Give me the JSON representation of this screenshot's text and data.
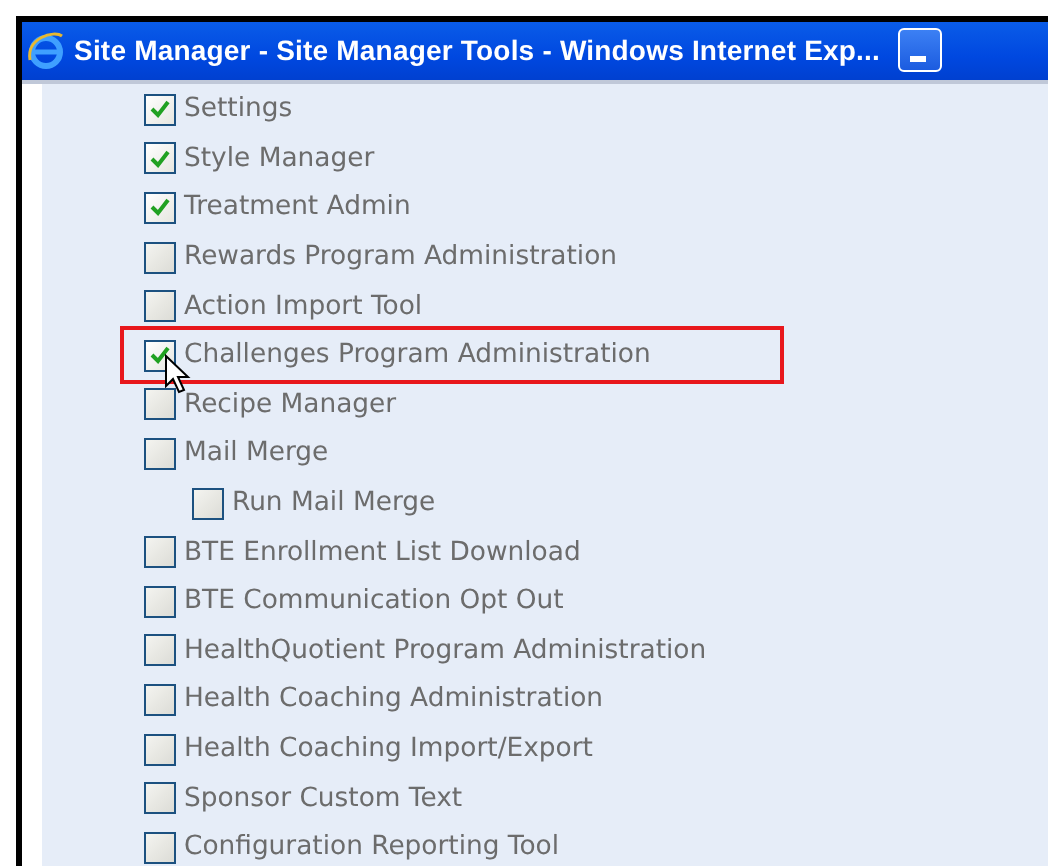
{
  "window": {
    "title": "Site Manager - Site Manager Tools - Windows Internet Exp..."
  },
  "items": [
    {
      "label": "Settings",
      "checked": true,
      "highlighted": false
    },
    {
      "label": "Style Manager",
      "checked": true,
      "highlighted": false
    },
    {
      "label": "Treatment Admin",
      "checked": true,
      "highlighted": false
    },
    {
      "label": "Rewards Program Administration",
      "checked": false,
      "highlighted": false
    },
    {
      "label": "Action Import Tool",
      "checked": false,
      "highlighted": false
    },
    {
      "label": "Challenges Program Administration",
      "checked": true,
      "highlighted": true
    },
    {
      "label": "Recipe Manager",
      "checked": false,
      "highlighted": false
    },
    {
      "label": "Mail Merge",
      "checked": false,
      "highlighted": false,
      "children": [
        {
          "label": "Run Mail Merge",
          "checked": false,
          "highlighted": false
        }
      ]
    },
    {
      "label": "BTE Enrollment List Download",
      "checked": false,
      "highlighted": false
    },
    {
      "label": "BTE Communication Opt Out",
      "checked": false,
      "highlighted": false
    },
    {
      "label": "HealthQuotient Program Administration",
      "checked": false,
      "highlighted": false
    },
    {
      "label": "Health Coaching Administration",
      "checked": false,
      "highlighted": false
    },
    {
      "label": "Health Coaching Import/Export",
      "checked": false,
      "highlighted": false
    },
    {
      "label": "Sponsor Custom Text",
      "checked": false,
      "highlighted": false
    },
    {
      "label": "Configuration Reporting Tool",
      "checked": false,
      "highlighted": false
    }
  ]
}
